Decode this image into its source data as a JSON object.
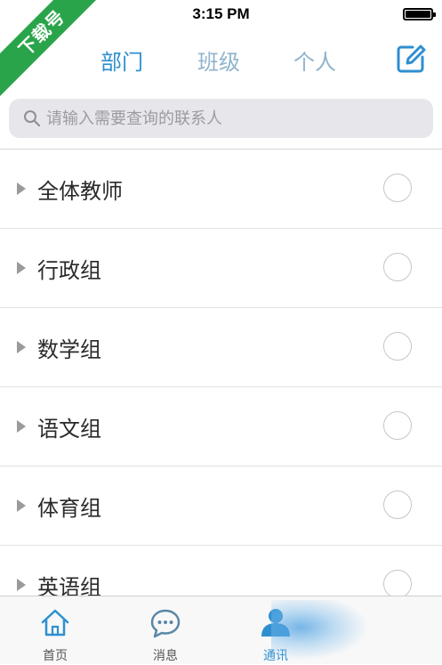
{
  "status_bar": {
    "time": "3:15 PM"
  },
  "watermark": {
    "text": "下载号"
  },
  "nav": {
    "tabs": [
      {
        "label": "部门",
        "active": true
      },
      {
        "label": "班级",
        "active": false
      },
      {
        "label": "个人",
        "active": false
      }
    ],
    "compose_icon": "compose-icon"
  },
  "search": {
    "placeholder": "请输入需要查询的联系人",
    "value": ""
  },
  "groups": [
    {
      "label": "全体教师",
      "checked": false
    },
    {
      "label": "行政组",
      "checked": false
    },
    {
      "label": "数学组",
      "checked": false
    },
    {
      "label": "语文组",
      "checked": false
    },
    {
      "label": "体育组",
      "checked": false
    },
    {
      "label": "英语组",
      "checked": false
    }
  ],
  "tabbar": {
    "items": [
      {
        "label": "首页",
        "icon": "home-icon",
        "active": false
      },
      {
        "label": "消息",
        "icon": "chat-icon",
        "active": false
      },
      {
        "label": "通讯",
        "icon": "contacts-icon",
        "active": true
      }
    ]
  },
  "colors": {
    "accent": "#2e8fd0",
    "tab_inactive": "#8fb3cc",
    "search_bg": "#e6e6eb",
    "watermark_bg": "#2aa44a"
  }
}
